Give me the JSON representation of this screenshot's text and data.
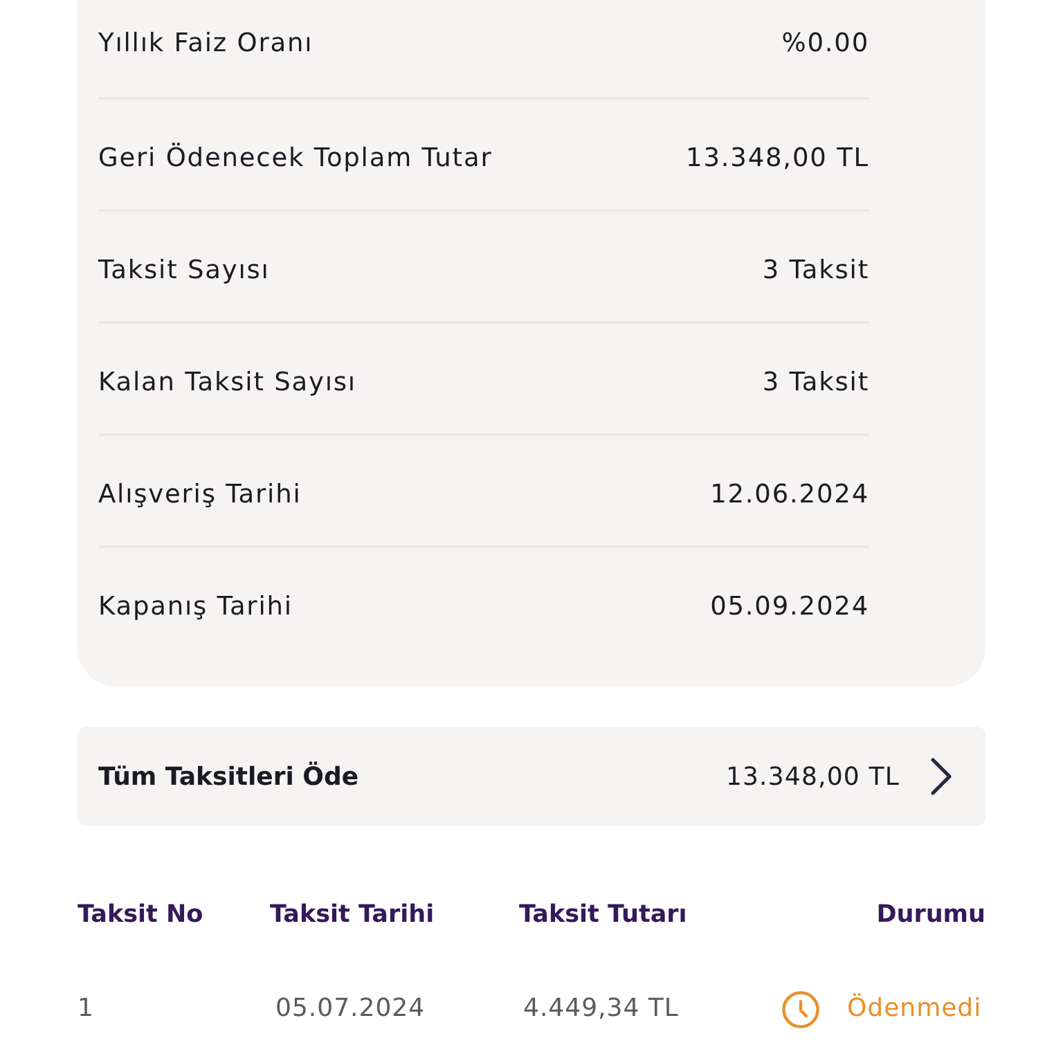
{
  "details": [
    {
      "label": "Yıllık Faiz Oranı",
      "value": "%0.00"
    },
    {
      "label": "Geri Ödenecek Toplam Tutar",
      "value": "13.348,00 TL"
    },
    {
      "label": "Taksit Sayısı",
      "value": "3 Taksit"
    },
    {
      "label": "Kalan Taksit Sayısı",
      "value": "3 Taksit"
    },
    {
      "label": "Alışveriş Tarihi",
      "value": "12.06.2024"
    },
    {
      "label": "Kapanış Tarihi",
      "value": "05.09.2024"
    }
  ],
  "pay_all": {
    "label": "Tüm Taksitleri Öde",
    "amount": "13.348,00 TL"
  },
  "installments": {
    "columns": [
      "Taksit No",
      "Taksit Tarihi",
      "Taksit Tutarı",
      "Durumu"
    ],
    "rows": [
      {
        "no": "1",
        "date": "05.07.2024",
        "amount": "4.449,34 TL",
        "status": "Ödenmedi",
        "paid": false
      }
    ]
  }
}
